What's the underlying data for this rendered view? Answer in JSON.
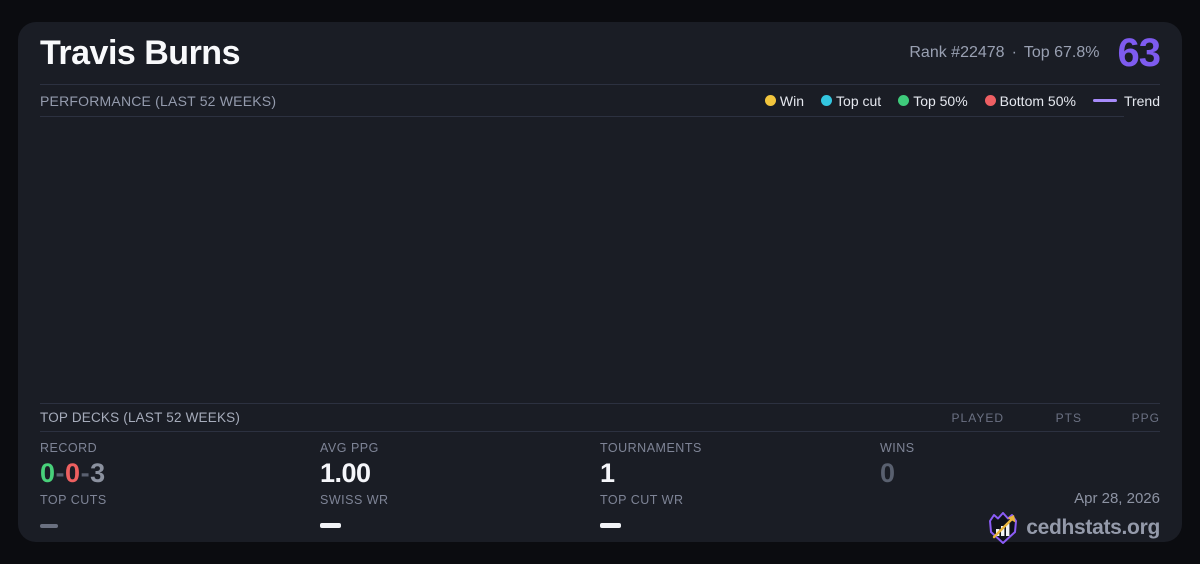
{
  "header": {
    "player_name": "Travis Burns",
    "rank": "Rank #22478",
    "separator": "·",
    "top_percent": "Top 67.8%",
    "score": "63"
  },
  "performance": {
    "title": "PERFORMANCE (LAST 52 WEEKS)",
    "legend": [
      {
        "label": "Win",
        "color": "#f2c53d",
        "type": "dot"
      },
      {
        "label": "Top cut",
        "color": "#33c6e0",
        "type": "dot"
      },
      {
        "label": "Top 50%",
        "color": "#3ecb7b",
        "type": "dot"
      },
      {
        "label": "Bottom 50%",
        "color": "#ee5f63",
        "type": "dot"
      },
      {
        "label": "Trend",
        "color": "#a78bfa",
        "type": "line"
      }
    ]
  },
  "chart_data": {
    "type": "scatter",
    "series": [],
    "title": "PERFORMANCE (LAST 52 WEEKS)"
  },
  "top_decks": {
    "title": "TOP DECKS (LAST 52 WEEKS)",
    "columns": [
      "PLAYED",
      "PTS",
      "PPG"
    ],
    "rows": []
  },
  "stats": {
    "record": {
      "label": "RECORD",
      "wins": "0",
      "losses": "0",
      "draws": "3",
      "separator": "-"
    },
    "avg_ppg": {
      "label": "AVG PPG",
      "value": "1.00"
    },
    "tournaments": {
      "label": "TOURNAMENTS",
      "value": "1"
    },
    "wins": {
      "label": "WINS",
      "value": "0"
    },
    "top_cuts": {
      "label": "TOP CUTS",
      "value": "—"
    },
    "swiss_wr": {
      "label": "SWISS WR",
      "value": "—"
    },
    "top_cut_wr": {
      "label": "TOP CUT WR",
      "value": "—"
    }
  },
  "footer": {
    "date": "Apr 28, 2026",
    "brand": "cedhstats.org"
  },
  "colors": {
    "accent_purple": "#7e5bef",
    "trend_purple": "#a78bfa",
    "win_yellow": "#f2c53d",
    "top_cut_cyan": "#33c6e0",
    "top50_green": "#3ecb7b",
    "bottom50_red": "#ee5f63",
    "record_win_green": "#48d17a",
    "record_loss_red": "#ee6060",
    "record_draw_gray": "#8b919f",
    "record_sep_gray": "#5a6070",
    "dim_value_gray": "#59606f"
  }
}
